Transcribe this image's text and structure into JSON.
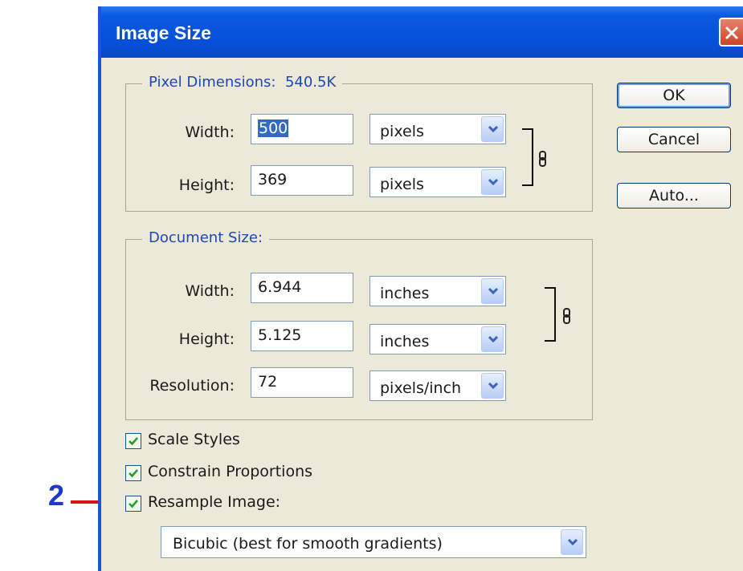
{
  "annotation": {
    "number": "2"
  },
  "dialog": {
    "title": "Image Size",
    "buttons": {
      "ok": "OK",
      "cancel": "Cancel",
      "auto": "Auto..."
    }
  },
  "pixel_dimensions": {
    "title": "Pixel Dimensions:",
    "size": "540.5K",
    "width_label": "Width:",
    "width_value": "500",
    "width_unit": "pixels",
    "height_label": "Height:",
    "height_value": "369",
    "height_unit": "pixels"
  },
  "document_size": {
    "title": "Document Size:",
    "width_label": "Width:",
    "width_value": "6.944",
    "width_unit": "inches",
    "height_label": "Height:",
    "height_value": "5.125",
    "height_unit": "inches",
    "resolution_label": "Resolution:",
    "resolution_value": "72",
    "resolution_unit": "pixels/inch"
  },
  "options": {
    "scale_styles": {
      "label": "Scale Styles",
      "checked": true
    },
    "constrain_proportions": {
      "label": "Constrain Proportions",
      "checked": true
    },
    "resample_image": {
      "label": "Resample Image:",
      "checked": true
    },
    "resample_method": "Bicubic (best for smooth gradients)"
  },
  "icons": {
    "close": "close-icon",
    "chain": "chain-link-icon",
    "dropdown": "chevron-down-icon",
    "checkmark": "checkmark-icon"
  },
  "colors": {
    "titlebar": "#0550da",
    "group_title": "#1e46b8",
    "annotation_number": "#2038c8",
    "annotation_arrow": "#d81414",
    "dialog_bg": "#ece9d8"
  }
}
